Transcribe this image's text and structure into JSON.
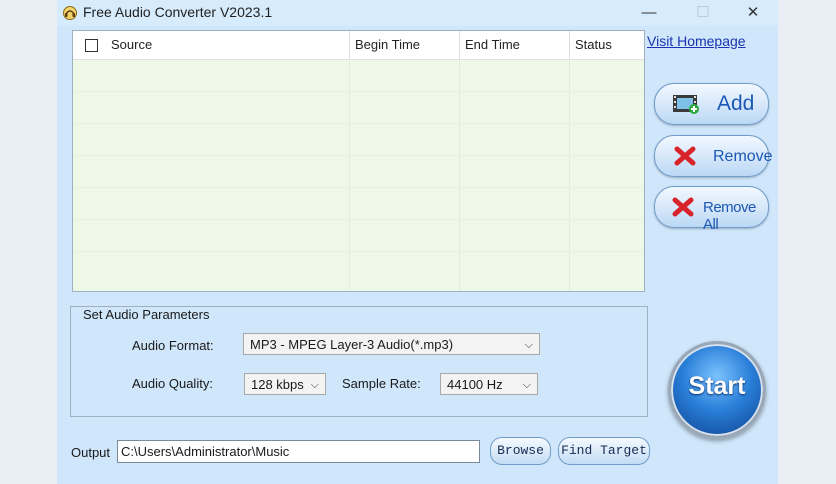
{
  "window": {
    "title": "Free Audio Converter V2023.1"
  },
  "list": {
    "columns": [
      "Source",
      "Begin Time",
      "End Time",
      "Status"
    ]
  },
  "links": {
    "visit_homepage": "Visit Homepage"
  },
  "buttons": {
    "add": "Add",
    "remove": "Remove",
    "remove_all": "Remove All",
    "start": "Start",
    "browse": "Browse",
    "find_target": "Find Target"
  },
  "params": {
    "group_title": "Set Audio Parameters",
    "format_label": "Audio Format:",
    "format_value": "MP3 - MPEG Layer-3 Audio(*.mp3)",
    "quality_label": "Audio Quality:",
    "quality_value": "128 kbps",
    "sample_rate_label": "Sample Rate:",
    "sample_rate_value": "44100 Hz"
  },
  "output": {
    "label": "Output",
    "path": "C:\\Users\\Administrator\\Music"
  },
  "icons": {
    "app": "app-logo-icon",
    "add": "film-add-icon",
    "remove": "red-x-icon",
    "remove_all": "red-x-icon",
    "dropdown": "chevron-down-icon"
  },
  "colors": {
    "window_bg": "#cfe6fb",
    "list_bg": "#eef8e6",
    "accent_blue": "#1c58b4",
    "link": "#1a33b0",
    "remove_red": "#d8232a"
  }
}
